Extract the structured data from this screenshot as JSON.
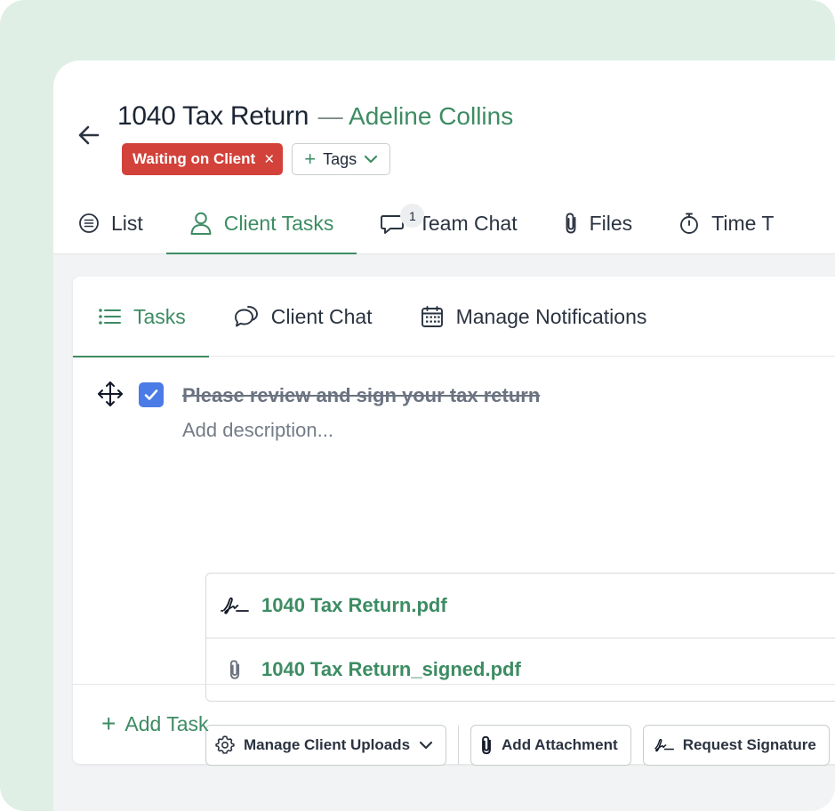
{
  "header": {
    "title": "1040 Tax Return",
    "separator": "—",
    "client_name": "Adeline Collins",
    "status_chip": {
      "label": "Waiting on Client",
      "close_glyph": "×",
      "color": "#d2423a"
    },
    "tags_button": {
      "plus": "+",
      "label": "Tags"
    }
  },
  "top_tabs": [
    {
      "label": "List",
      "icon": "list-circle-icon",
      "active": false
    },
    {
      "label": "Client Tasks",
      "icon": "user-icon",
      "active": true
    },
    {
      "label": "Team Chat",
      "icon": "chat-bubble-icon",
      "badge": "1",
      "active": false
    },
    {
      "label": "Files",
      "icon": "paperclip-icon",
      "active": false
    },
    {
      "label": "Time T",
      "icon": "stopwatch-icon",
      "active": false
    }
  ],
  "inner_tabs": [
    {
      "label": "Tasks",
      "icon": "list-icon",
      "active": true
    },
    {
      "label": "Client Chat",
      "icon": "chat-bubbles-icon",
      "active": false
    },
    {
      "label": "Manage Notifications",
      "icon": "calendar-icon",
      "active": false
    }
  ],
  "task": {
    "title": "Please review and sign your tax return",
    "description_placeholder": "Add description...",
    "completed": true,
    "files": [
      {
        "name": "1040 Tax Return.pdf",
        "icon": "signature-icon"
      },
      {
        "name": "1040 Tax Return_signed.pdf",
        "icon": "paperclip-icon"
      }
    ],
    "actions": {
      "manage_uploads": "Manage Client Uploads",
      "add_attachment": "Add Attachment",
      "request_signature": "Request Signature"
    }
  },
  "add_task": {
    "plus": "+",
    "label": "Add Task"
  },
  "colors": {
    "accent": "#3d8c63",
    "status_red": "#d2423a",
    "checkbox_blue": "#4b7be6",
    "frame_bg": "#dfefe5"
  }
}
